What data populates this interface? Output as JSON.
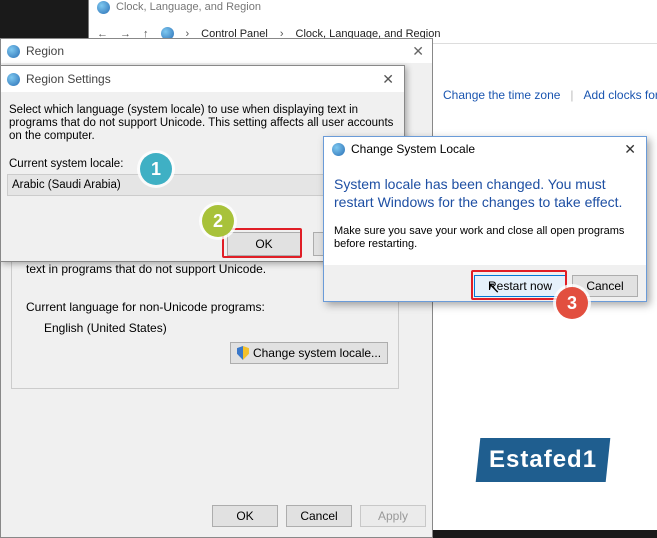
{
  "control_panel": {
    "title": "Clock, Language, and Region",
    "breadcrumb": [
      "Control Panel",
      "Clock, Language, and Region"
    ],
    "links": [
      "Change the time zone",
      "Add clocks for d"
    ]
  },
  "region_dialog": {
    "title": "Region",
    "panel_text": "text in programs that do not support Unicode.",
    "current_label": "Current language for non-Unicode programs:",
    "current_value": "English (United States)",
    "change_button": "Change system locale...",
    "ok": "OK",
    "cancel": "Cancel",
    "apply": "Apply"
  },
  "region_settings": {
    "title": "Region Settings",
    "description": "Select which language (system locale) to use when displaying text in programs that do not support Unicode. This setting affects all user accounts on the computer.",
    "current_label": "Current system locale:",
    "current_value": "Arabic (Saudi Arabia)",
    "ok": "OK"
  },
  "locale_dialog": {
    "title": "Change System Locale",
    "message": "System locale has been changed. You must restart Windows for the changes to take effect.",
    "note": "Make sure you save your work and close all open programs before restarting.",
    "restart": "Restart now",
    "cancel": "Cancel"
  },
  "annotations": {
    "step1": "1",
    "step2": "2",
    "step3": "3",
    "watermark": "Estafed1"
  },
  "colors": {
    "highlight": "#e01e26",
    "step1": "#3fb0c4",
    "step2": "#a8c23a",
    "step3": "#e24f3f",
    "link": "#1a55b0"
  }
}
